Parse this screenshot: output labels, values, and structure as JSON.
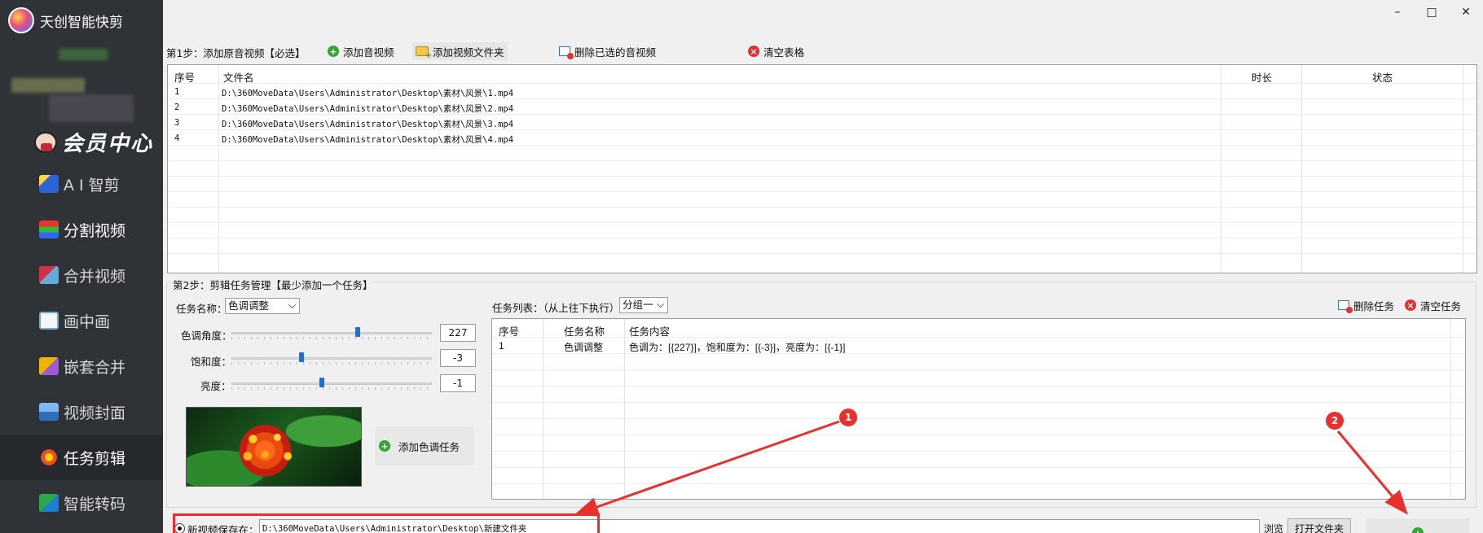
{
  "app": {
    "title": "天创智能快剪",
    "window_controls": [
      "–",
      "□",
      "✕"
    ]
  },
  "sidebar": {
    "member_label": "会员中心",
    "items": [
      {
        "label": "A I 智剪",
        "icon": "ai-cut-icon"
      },
      {
        "label": "分割视频",
        "icon": "split-video-icon"
      },
      {
        "label": "合并视频",
        "icon": "merge-video-icon"
      },
      {
        "label": "画中画",
        "icon": "picture-in-picture-icon"
      },
      {
        "label": "嵌套合并",
        "icon": "nested-merge-icon"
      },
      {
        "label": "视频封面",
        "icon": "video-cover-icon"
      },
      {
        "label": "任务剪辑",
        "icon": "task-edit-icon",
        "active": true
      },
      {
        "label": "智能转码",
        "icon": "transcode-icon"
      }
    ]
  },
  "step1": {
    "label": "第1步：添加原音视频【必选】",
    "add_audio_video": "添加音视频",
    "add_video_folder": "添加视频文件夹",
    "delete_selected": "删除已选的音视频",
    "clear_table": "清空表格"
  },
  "file_table": {
    "columns": [
      "序号",
      "文件名",
      "时长",
      "状态"
    ],
    "rows": [
      {
        "index": "1",
        "filename": "D:\\360MoveData\\Users\\Administrator\\Desktop\\素材\\风景\\1.mp4",
        "duration": "",
        "status": ""
      },
      {
        "index": "2",
        "filename": "D:\\360MoveData\\Users\\Administrator\\Desktop\\素材\\风景\\2.mp4",
        "duration": "",
        "status": ""
      },
      {
        "index": "3",
        "filename": "D:\\360MoveData\\Users\\Administrator\\Desktop\\素材\\风景\\3.mp4",
        "duration": "",
        "status": ""
      },
      {
        "index": "4",
        "filename": "D:\\360MoveData\\Users\\Administrator\\Desktop\\素材\\风景\\4.mp4",
        "duration": "",
        "status": ""
      }
    ]
  },
  "step2": {
    "label": "第2步：剪辑任务管理【最少添加一个任务】",
    "task_name_label": "任务名称：",
    "task_name_value": "色调调整",
    "hue_label": "色调角度：",
    "hue_value": "227",
    "hue_fraction": 0.63,
    "saturation_label": "饱和度：",
    "saturation_value": "-3",
    "saturation_fraction": 0.35,
    "brightness_label": "亮度：",
    "brightness_value": "-1",
    "brightness_fraction": 0.45,
    "add_task_button": "添加色调任务",
    "task_list_label": "任务列表：（从上往下执行）",
    "group_value": "分组一",
    "delete_task": "删除任务",
    "clear_tasks": "清空任务",
    "task_columns": [
      "序号",
      "任务名称",
      "任务内容"
    ],
    "tasks": [
      {
        "index": "1",
        "name": "色调调整",
        "content": "色调为：[{227}]，饱和度为：[{-3}]，亮度为：[{-1}]"
      }
    ]
  },
  "output": {
    "save_label": "新视频保存在：",
    "path": "D:\\360MoveData\\Users\\Administrator\\Desktop\\新建文件夹",
    "browse": "浏览",
    "open_folder": "打开文件夹"
  },
  "annotations": {
    "badge_1": "1",
    "badge_2": "2"
  },
  "colors": {
    "sidebar_bg": "#2f3337",
    "accent_red": "#e8302e",
    "slider_thumb": "#1e6fd1"
  }
}
